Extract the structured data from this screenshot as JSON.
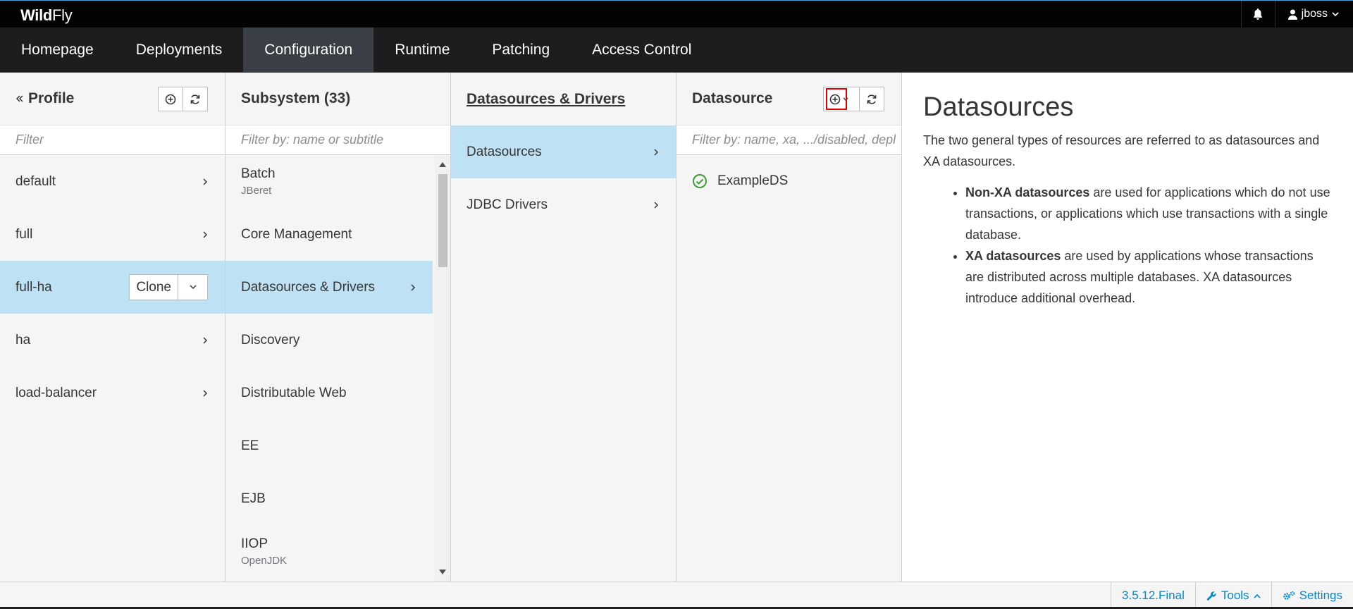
{
  "brand": {
    "bold": "Wild",
    "light": "Fly"
  },
  "topbar": {
    "user": "jboss",
    "bell_icon": "bell-icon",
    "user_icon": "user-icon"
  },
  "nav": {
    "items": [
      "Homepage",
      "Deployments",
      "Configuration",
      "Runtime",
      "Patching",
      "Access Control"
    ],
    "active": "Configuration"
  },
  "profile_col": {
    "title": "Profile",
    "filter_placeholder": "Filter",
    "items": [
      "default",
      "full",
      "full-ha",
      "ha",
      "load-balancer"
    ],
    "active": "full-ha",
    "clone_label": "Clone"
  },
  "subsystem_col": {
    "title": "Subsystem (33)",
    "filter_placeholder": "Filter by: name or subtitle",
    "items": [
      {
        "label": "Batch",
        "subtitle": "JBeret"
      },
      {
        "label": "Core Management",
        "subtitle": ""
      },
      {
        "label": "Datasources & Drivers",
        "subtitle": ""
      },
      {
        "label": "Discovery",
        "subtitle": ""
      },
      {
        "label": "Distributable Web",
        "subtitle": ""
      },
      {
        "label": "EE",
        "subtitle": ""
      },
      {
        "label": "EJB",
        "subtitle": ""
      },
      {
        "label": "IIOP",
        "subtitle": "OpenJDK"
      }
    ],
    "active": "Datasources & Drivers"
  },
  "dsdrivers_col": {
    "title": "Datasources & Drivers",
    "items": [
      "Datasources",
      "JDBC Drivers"
    ],
    "active": "Datasources"
  },
  "datasource_col": {
    "title": "Datasource",
    "filter_placeholder": "Filter by: name, xa, .../disabled, depl",
    "items": [
      {
        "label": "ExampleDS",
        "status": "ok"
      }
    ]
  },
  "preview": {
    "heading": "Datasources",
    "intro": "The two general types of resources are referred to as datasources and XA datasources.",
    "bullets": [
      {
        "bold": "Non-XA datasources",
        "text": " are used for applications which do not use transactions, or applications which use transactions with a single database."
      },
      {
        "bold": "XA datasources",
        "text": " are used by applications whose transactions are distributed across multiple databases. XA datasources introduce additional overhead."
      }
    ]
  },
  "footer": {
    "version": "3.5.12.Final",
    "tools": "Tools",
    "settings": "Settings"
  },
  "colors": {
    "accent": "#0088ce",
    "active_row": "#bee1f4",
    "ok": "#3f9c35",
    "highlight": "#e00000"
  }
}
